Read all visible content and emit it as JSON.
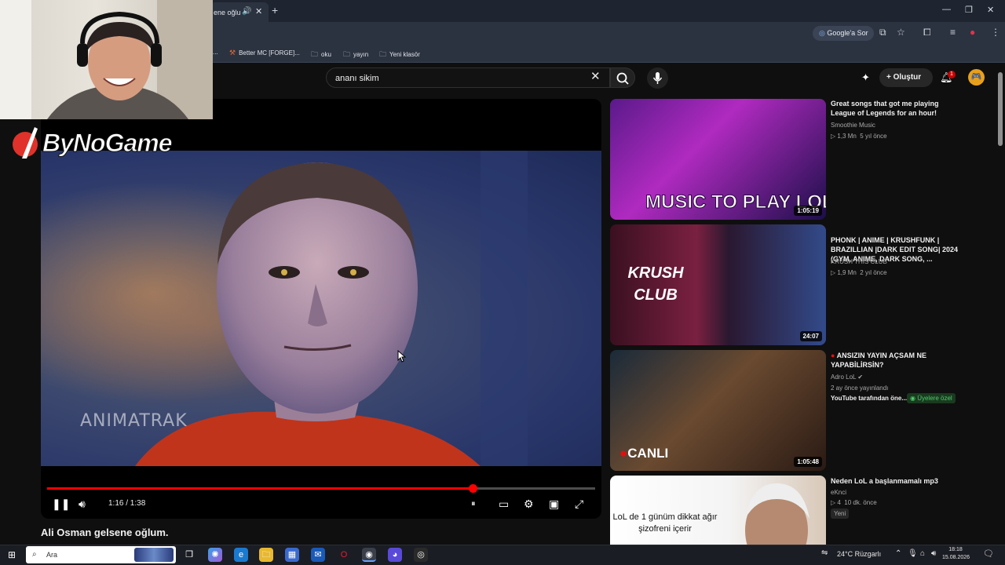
{
  "browser": {
    "tab_title": "ene oğlu",
    "bookmarks": [
      {
        "label": "..."
      },
      {
        "label": "Better MC [FORGE]..."
      },
      {
        "label": "oku"
      },
      {
        "label": "yayın"
      },
      {
        "label": "Yeni klasör"
      }
    ],
    "google_button": "Google'a Sor"
  },
  "youtube": {
    "search_query": "ananı sikim",
    "create_label": "Oluştur",
    "notification_count": "1",
    "player": {
      "time": "1:16 / 1:38",
      "progress": 0.776,
      "watermark": "ANIMATRAK"
    },
    "video_title": "Ali Osman gelsene oğlum.",
    "recommendations": [
      {
        "title": "Great songs that got me playing League of Legends for an hour!",
        "channel": "Smoothie Music",
        "views": "▷ 1,3 Mn",
        "age": "5 yıl önce",
        "duration": "1:05:19",
        "thumb_text": "MUSIC TO PLAY LOL"
      },
      {
        "title": "PHONK | ANIME | KRUSHFUNK | BRAZILLIAN |DARK EDIT SONG| 2024 (GYM, ANIME, DARK SONG, ...",
        "channel": "KRUSH THIS CLUB",
        "views": "▷ 1,9 Mn",
        "age": "2 yıl önce",
        "duration": "24:07",
        "thumb_text": "KRUSH CLUB"
      },
      {
        "title": "ANSIZIN YAYIN AÇSAM NE YAPABİLİRSİN?",
        "channel": "Adro LoL",
        "streamed": "2 ay önce yayınlandı",
        "promo": "YouTube tarafından öne...",
        "members": "Üyelere özel",
        "duration": "1:05:48",
        "thumb_text": "CANLI"
      },
      {
        "title": "Neden LoL a başlanmamalı mp3",
        "channel": "eKnci",
        "views": "▷ 4",
        "age": "10 dk. önce",
        "badge": "Yeni",
        "thumb_text": "LoL de 1 günüm dikkat ağır şizofreni içerir"
      }
    ]
  },
  "overlay": {
    "brand": "ByNoGame"
  },
  "taskbar": {
    "search_placeholder": "Ara",
    "weather": "24°C  Rüzgarlı",
    "time": "18:18",
    "date": "15.08.2026"
  }
}
